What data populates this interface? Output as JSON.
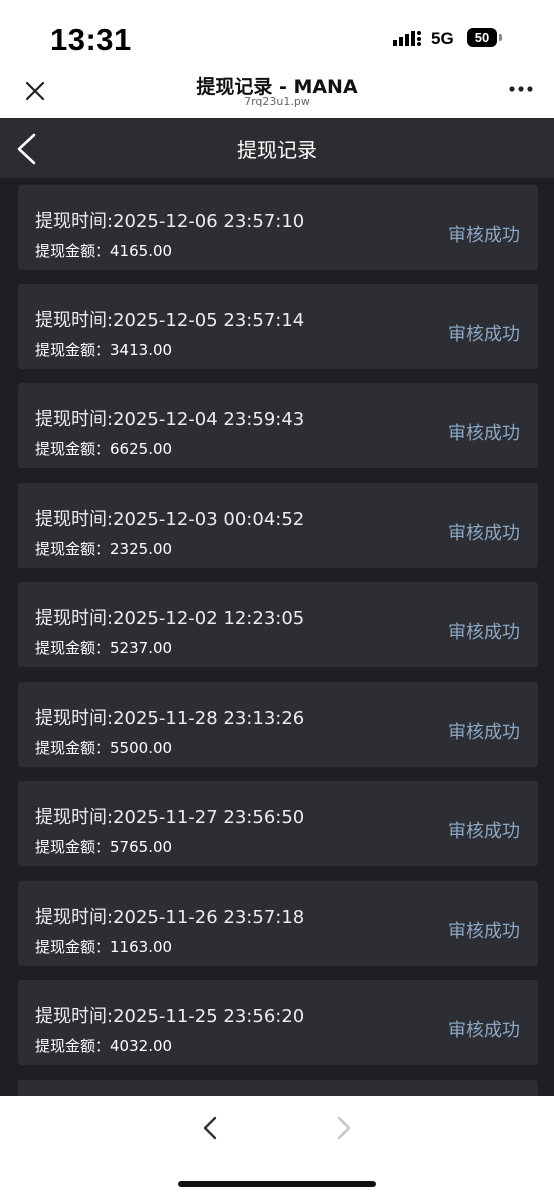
{
  "status_bar": {
    "time": "13:31",
    "network": "5G",
    "battery": "50"
  },
  "browser": {
    "title": "提现记录 - MANA",
    "url": "7rq23u1.pw"
  },
  "nav": {
    "title": "提现记录"
  },
  "records": [
    {
      "time_label": "提现时间:",
      "time": "2025-12-06 23:57:10",
      "amount_label": "提现金额：",
      "amount": "4165.00",
      "status": "审核成功"
    },
    {
      "time_label": "提现时间:",
      "time": "2025-12-05 23:57:14",
      "amount_label": "提现金额：",
      "amount": "3413.00",
      "status": "审核成功"
    },
    {
      "time_label": "提现时间:",
      "time": "2025-12-04 23:59:43",
      "amount_label": "提现金额：",
      "amount": "6625.00",
      "status": "审核成功"
    },
    {
      "time_label": "提现时间:",
      "time": "2025-12-03 00:04:52",
      "amount_label": "提现金额：",
      "amount": "2325.00",
      "status": "审核成功"
    },
    {
      "time_label": "提现时间:",
      "time": "2025-12-02 12:23:05",
      "amount_label": "提现金额：",
      "amount": "5237.00",
      "status": "审核成功"
    },
    {
      "time_label": "提现时间:",
      "time": "2025-11-28 23:13:26",
      "amount_label": "提现金额：",
      "amount": "5500.00",
      "status": "审核成功"
    },
    {
      "time_label": "提现时间:",
      "time": "2025-11-27 23:56:50",
      "amount_label": "提现金额：",
      "amount": "5765.00",
      "status": "审核成功"
    },
    {
      "time_label": "提现时间:",
      "time": "2025-11-26 23:57:18",
      "amount_label": "提现金额：",
      "amount": "1163.00",
      "status": "审核成功"
    },
    {
      "time_label": "提现时间:",
      "time": "2025-11-25 23:56:20",
      "amount_label": "提现金额：",
      "amount": "4032.00",
      "status": "审核成功"
    }
  ],
  "colors": {
    "page_background": "#1d1f23",
    "card_background": "#2d2e33",
    "nav_background": "#2b2d31",
    "status_text": "#8aa7c6"
  }
}
